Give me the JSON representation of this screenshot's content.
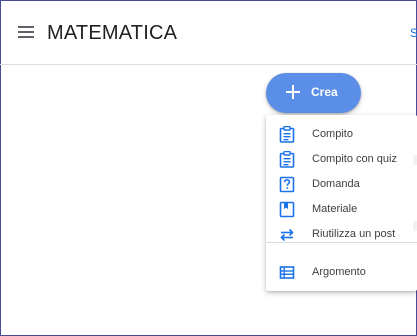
{
  "header": {
    "menu_icon": "hamburger-menu-icon",
    "title": "MATEMATICA",
    "clipped_link": "S"
  },
  "fab": {
    "icon": "plus-icon",
    "label": "Crea",
    "color": "#5b8ee6"
  },
  "menu": {
    "items": [
      {
        "label": "Compito",
        "icon": "assignment-icon"
      },
      {
        "label": "Compito con quiz",
        "icon": "quiz-assignment-icon"
      },
      {
        "label": "Domanda",
        "icon": "question-icon"
      },
      {
        "label": "Materiale",
        "icon": "material-icon"
      },
      {
        "label": "Riutilizza un post",
        "icon": "reuse-post-icon"
      },
      {
        "label": "Argomento",
        "icon": "topic-icon"
      }
    ]
  },
  "colors": {
    "accent": "#1a73e8",
    "icon": "#1a73e8",
    "border": "#4a4a9a"
  }
}
